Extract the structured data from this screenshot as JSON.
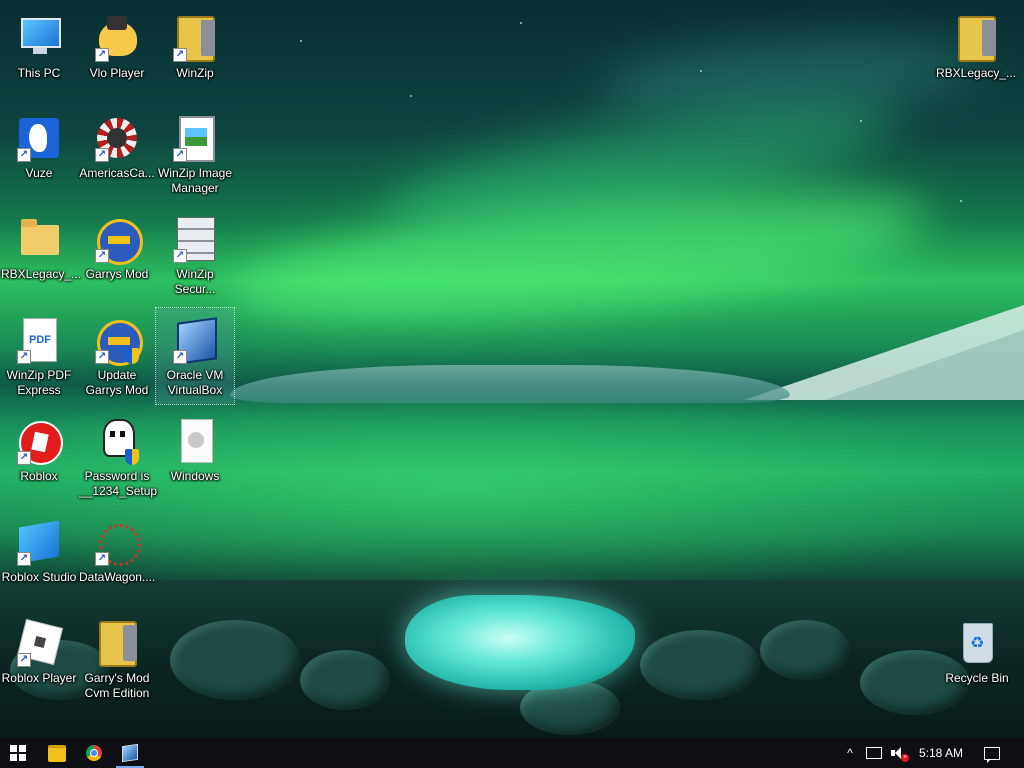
{
  "desktop": {
    "icons": [
      {
        "label": "This PC",
        "icon": "computer-icon"
      },
      {
        "label": "Vlo Player",
        "icon": "vlc-icon"
      },
      {
        "label": "WinZip",
        "icon": "winzip-icon"
      },
      {
        "label": "Vuze",
        "icon": "vuze-frog-icon"
      },
      {
        "label": "AmericasCa...",
        "icon": "casino-chip-icon"
      },
      {
        "label": "WinZip Image Manager",
        "icon": "winzip-image-icon"
      },
      {
        "label": "RBXLegacy_...",
        "icon": "folder-icon"
      },
      {
        "label": "Garrys Mod",
        "icon": "gmod-icon"
      },
      {
        "label": "WinZip Secur...",
        "icon": "winzip-secure-icon"
      },
      {
        "label": "WinZip PDF Express",
        "icon": "pdf-icon"
      },
      {
        "label": "Update Garrys Mod",
        "icon": "gmod-update-icon"
      },
      {
        "label": "Oracle VM VirtualBox",
        "icon": "virtualbox-icon"
      },
      {
        "label": "Roblox",
        "icon": "roblox-icon"
      },
      {
        "label": "Password is __1234_Setup",
        "icon": "skull-setup-icon"
      },
      {
        "label": "Windows",
        "icon": "windows-file-icon"
      },
      {
        "label": "Roblox Studio",
        "icon": "roblox-studio-icon"
      },
      {
        "label": "DataWagon....",
        "icon": "datawagon-icon"
      },
      {
        "label": "Roblox Player",
        "icon": "roblox-player-icon"
      },
      {
        "label": "Garry's Mod Cvm Edition",
        "icon": "zip-archive-icon"
      },
      {
        "label": "RBXLegacy_...",
        "icon": "zip-archive-icon"
      },
      {
        "label": "Recycle Bin",
        "icon": "recycle-bin-icon"
      }
    ],
    "selected_icon": "Oracle VM VirtualBox"
  },
  "taskbar": {
    "pinned": [
      {
        "name": "Start",
        "icon": "windows-logo-icon"
      },
      {
        "name": "File Explorer",
        "icon": "file-explorer-icon"
      },
      {
        "name": "Google Chrome",
        "icon": "chrome-icon"
      },
      {
        "name": "Oracle VM VirtualBox",
        "icon": "virtualbox-icon",
        "active": true
      }
    ],
    "tray": {
      "chevron": "^",
      "time": "5:18 AM",
      "volume_muted": true
    }
  },
  "colors": {
    "taskbar_bg": "#0d0f12",
    "aurora": "#2ec060",
    "label_text": "#ffffff"
  }
}
